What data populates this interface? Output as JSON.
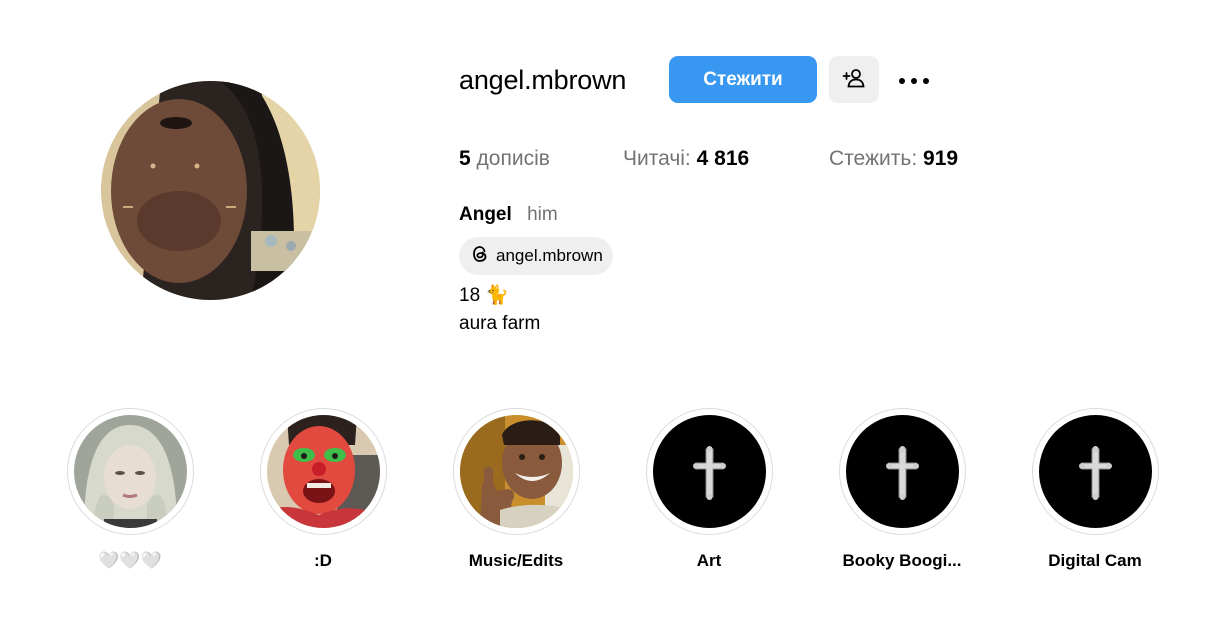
{
  "profile": {
    "username": "angel.mbrown",
    "follow_label": "Стежити",
    "full_name": "Angel",
    "pronouns": "him",
    "threads_handle": "angel.mbrown",
    "bio_line1": "18 🐈",
    "bio_line2": "aura farm"
  },
  "stats": {
    "posts_count": "5",
    "posts_label": "дописів",
    "followers_label": "Читачі:",
    "followers_count": "4 816",
    "following_label": "Стежить:",
    "following_count": "919"
  },
  "highlights": [
    {
      "label": "🤍🤍🤍",
      "cover": "photo-girl"
    },
    {
      "label": ":D",
      "cover": "photo-clown"
    },
    {
      "label": "Music/Edits",
      "cover": "photo-thumbs-up"
    },
    {
      "label": "Art",
      "cover": "cross-on-black"
    },
    {
      "label": "Booky Boogi...",
      "cover": "cross-on-black"
    },
    {
      "label": "Digital Cam",
      "cover": "cross-on-black"
    }
  ],
  "icons": {
    "suggest": "person-plus-icon",
    "more": "more-horizontal-icon",
    "threads": "threads-logo-icon"
  },
  "colors": {
    "follow_button": "#3897f0",
    "secondary_button": "#efefef",
    "muted_text": "#737373",
    "ring_border": "#dbdbdb"
  }
}
